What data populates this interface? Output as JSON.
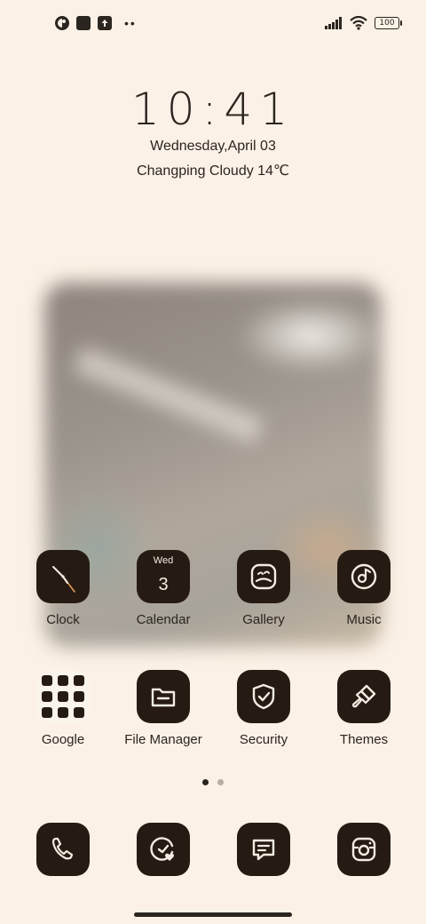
{
  "status_bar": {
    "battery_level": "100",
    "icons": [
      "app-notification-icon",
      "square-notification-icon",
      "upload-icon",
      "more-dots-icon",
      "signal-icon",
      "wifi-icon",
      "battery-icon"
    ]
  },
  "clock_widget": {
    "time": "10:41",
    "date": "Wednesday,April 03",
    "weather": "Changping Cloudy 14℃"
  },
  "apps_row1": [
    {
      "label": "Clock",
      "icon": "clock-icon"
    },
    {
      "label": "Calendar",
      "icon": "calendar-icon",
      "day": "Wed",
      "date": "3"
    },
    {
      "label": "Gallery",
      "icon": "gallery-icon"
    },
    {
      "label": "Music",
      "icon": "music-icon"
    }
  ],
  "apps_row2": [
    {
      "label": "Google",
      "icon": "google-folder-icon"
    },
    {
      "label": "File Manager",
      "icon": "folder-icon"
    },
    {
      "label": "Security",
      "icon": "shield-icon"
    },
    {
      "label": "Themes",
      "icon": "brush-icon"
    }
  ],
  "page_indicator": {
    "pages": 2,
    "current": 1
  },
  "dock": [
    {
      "icon": "phone-icon"
    },
    {
      "icon": "health-icon"
    },
    {
      "icon": "messages-icon"
    },
    {
      "icon": "camera-icon"
    }
  ],
  "colors": {
    "background": "#fbf1e6",
    "icon_bg": "#261b12",
    "icon_fg": "#f4ece2",
    "text": "#2b2520"
  }
}
